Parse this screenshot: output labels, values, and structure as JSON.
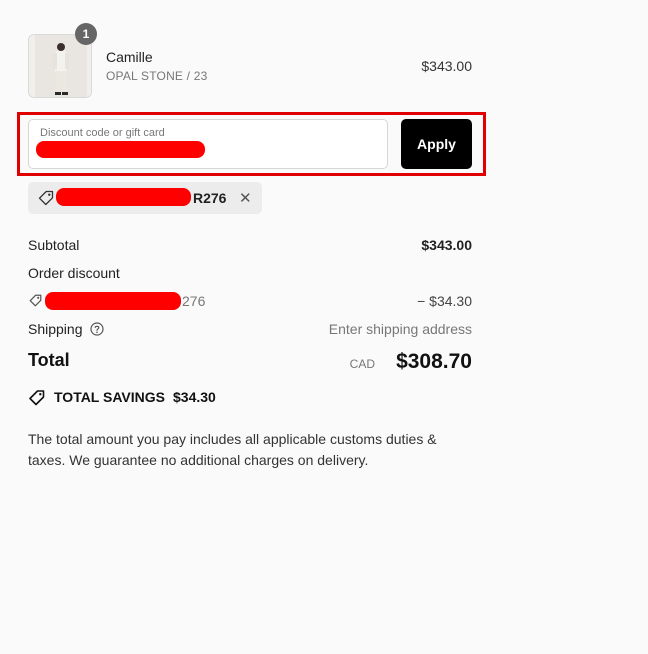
{
  "product": {
    "quantity": "1",
    "name": "Camille",
    "variant": "OPAL STONE / 23",
    "price": "$343.00"
  },
  "discount": {
    "label": "Discount code or gift card",
    "apply_label": "Apply"
  },
  "applied_code": {
    "visible_suffix": "R276",
    "remove_icon": "close-icon"
  },
  "summary": {
    "subtotal_label": "Subtotal",
    "subtotal_value": "$343.00",
    "order_discount_label": "Order discount",
    "discount_code_suffix": "276",
    "discount_value": "− $34.30",
    "shipping_label": "Shipping",
    "shipping_value": "Enter shipping address",
    "total_label": "Total",
    "currency": "CAD",
    "total_value": "$308.70"
  },
  "savings": {
    "label": "TOTAL SAVINGS",
    "amount": "$34.30"
  },
  "note": "The total amount you pay includes all applicable customs duties & taxes. We guarantee no additional charges on delivery.",
  "colors": {
    "highlight_border": "#e00000",
    "redaction": "#ff0000",
    "button_bg": "#000000"
  }
}
